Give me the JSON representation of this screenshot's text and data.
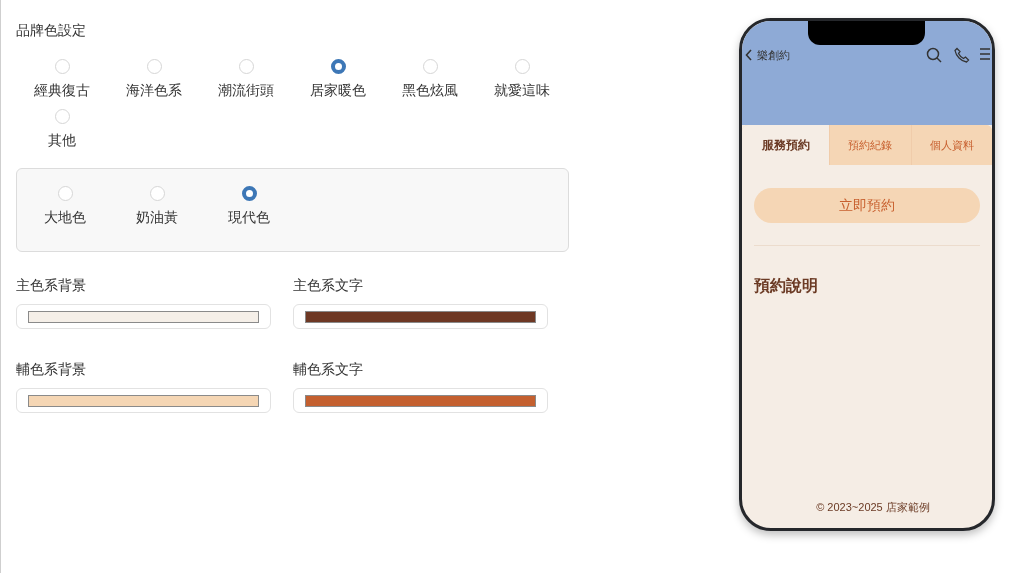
{
  "brand_color": {
    "label": "品牌色設定",
    "options": [
      {
        "label": "經典復古",
        "selected": false
      },
      {
        "label": "海洋色系",
        "selected": false
      },
      {
        "label": "潮流街頭",
        "selected": false
      },
      {
        "label": "居家暖色",
        "selected": true
      },
      {
        "label": "黑色炫風",
        "selected": false
      },
      {
        "label": "就愛這味",
        "selected": false
      },
      {
        "label": "其他",
        "selected": false
      }
    ],
    "variants": [
      {
        "label": "大地色",
        "selected": false
      },
      {
        "label": "奶油黃",
        "selected": false
      },
      {
        "label": "現代色",
        "selected": true
      }
    ]
  },
  "color_fields": [
    {
      "label": "主色系背景",
      "color": "#f5efe8"
    },
    {
      "label": "主色系文字",
      "color": "#6e3824"
    },
    {
      "label": "輔色系背景",
      "color": "#f5d6b4"
    },
    {
      "label": "輔色系文字",
      "color": "#c4602f"
    }
  ],
  "preview": {
    "title": "樂創約",
    "tabs": [
      {
        "label": "服務預約",
        "selected": true
      },
      {
        "label": "預約紀錄",
        "selected": false
      },
      {
        "label": "個人資料",
        "selected": false
      }
    ],
    "button": "立即預約",
    "section_title": "預約說明",
    "footer": "© 2023~2025 店家範例"
  }
}
